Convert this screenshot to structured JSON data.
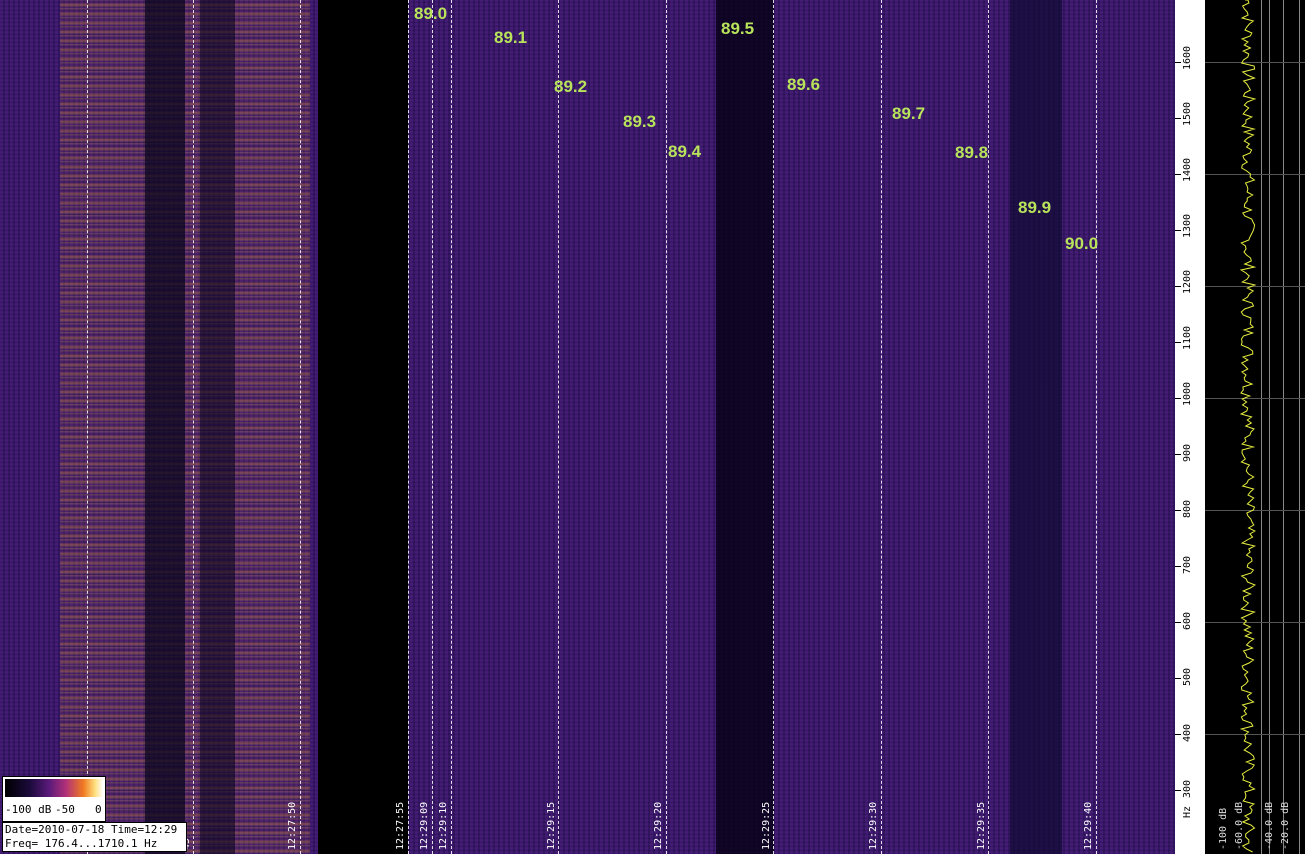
{
  "fm_labels": [
    "89.0",
    "89.1",
    "89.2",
    "89.3",
    "89.4",
    "89.5",
    "89.6",
    "89.7",
    "89.8",
    "89.9",
    "90.0"
  ],
  "time_labels": [
    "45",
    "12:27:50",
    "12:27:55",
    "12:29:09",
    "12:29:10",
    "12:29:15",
    "12:29:20",
    "12:29:25",
    "12:29:30",
    "12:29:35",
    "12:29:40"
  ],
  "freq_ticks": [
    "1600",
    "1500",
    "1400",
    "1300",
    "1200",
    "1100",
    "1000",
    "900",
    "800",
    "700",
    "600",
    "500",
    "400",
    "300",
    "Hz"
  ],
  "db_labels": [
    "-100 dB",
    "-60.0 dB",
    "-40.0 dB",
    "-20.0 dB"
  ],
  "colorbar": {
    "left": "-100 dB",
    "mid": "-50",
    "right": "0"
  },
  "info": {
    "line1": "Date=2010-07-18 Time=12:29",
    "line2": "Freq= 176.4...1710.1 Hz"
  },
  "colors": {
    "fm_label": "#b8e35a",
    "signal": "#ffb030",
    "background": "#3a1a6e"
  }
}
